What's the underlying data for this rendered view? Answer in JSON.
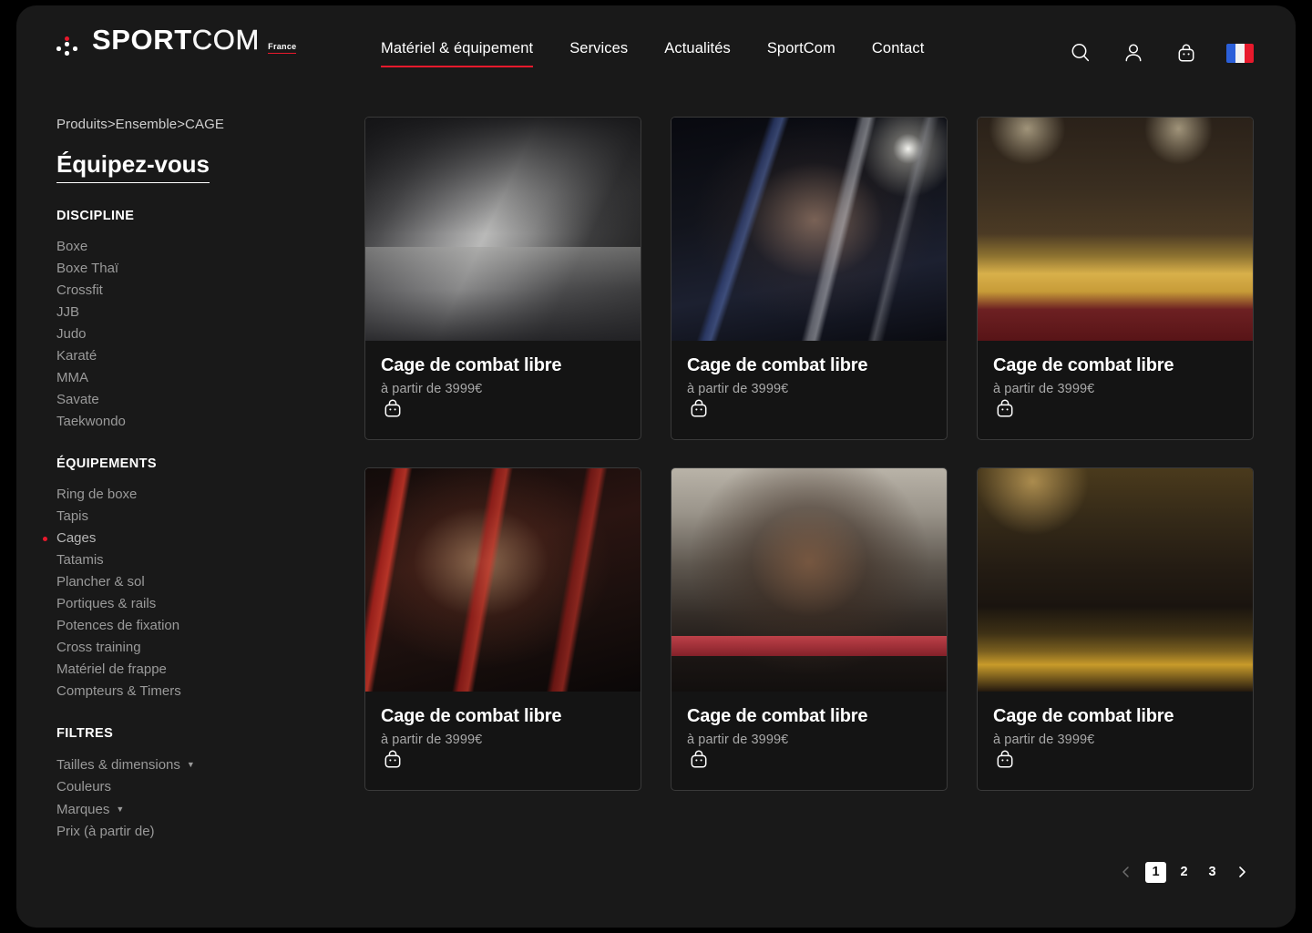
{
  "brand": {
    "name_bold": "SPORT",
    "name_thin": "COM",
    "sub": "France",
    "accent_color": "#e8192c"
  },
  "nav": {
    "items": [
      {
        "label": "Matériel & équipement",
        "active": true
      },
      {
        "label": "Services",
        "active": false
      },
      {
        "label": "Actualités",
        "active": false
      },
      {
        "label": "SportCom",
        "active": false
      },
      {
        "label": "Contact",
        "active": false
      }
    ]
  },
  "header_actions": {
    "search": "search-icon",
    "account": "user-icon",
    "cart": "shopping-bag-icon",
    "language": "fr-flag"
  },
  "sidebar": {
    "breadcrumb": "Produits>Ensemble>CAGE",
    "title": "Équipez-vous",
    "groups": [
      {
        "heading": "DISCIPLINE",
        "items": [
          {
            "label": "Boxe",
            "selected": false
          },
          {
            "label": "Boxe Thaï",
            "selected": false
          },
          {
            "label": "Crossfit",
            "selected": false
          },
          {
            "label": "JJB",
            "selected": false
          },
          {
            "label": "Judo",
            "selected": false
          },
          {
            "label": "Karaté",
            "selected": false
          },
          {
            "label": "MMA",
            "selected": false
          },
          {
            "label": "Savate",
            "selected": false
          },
          {
            "label": "Taekwondo",
            "selected": false
          }
        ]
      },
      {
        "heading": "ÉQUIPEMENTS",
        "items": [
          {
            "label": "Ring de boxe",
            "selected": false
          },
          {
            "label": "Tapis",
            "selected": false
          },
          {
            "label": "Cages",
            "selected": true
          },
          {
            "label": "Tatamis",
            "selected": false
          },
          {
            "label": "Plancher & sol",
            "selected": false
          },
          {
            "label": "Portiques & rails",
            "selected": false
          },
          {
            "label": "Potences de fixation",
            "selected": false
          },
          {
            "label": "Cross training",
            "selected": false
          },
          {
            "label": "Matériel de frappe",
            "selected": false
          },
          {
            "label": "Compteurs & Timers",
            "selected": false
          }
        ]
      },
      {
        "heading": "FILTRES",
        "items": [
          {
            "label": "Tailles & dimensions",
            "caret": "▼",
            "selected": false
          },
          {
            "label": "Couleurs",
            "selected": false
          },
          {
            "label": "Marques",
            "caret": "▼",
            "selected": false
          },
          {
            "label": "Prix (à partir de)",
            "selected": false
          }
        ]
      }
    ]
  },
  "products": [
    {
      "title": "Cage de combat libre",
      "price": "à partir de 3999€",
      "cart_icon": "shopping-bag-icon",
      "photo": "gym-cage-interior-grey"
    },
    {
      "title": "Cage de combat libre",
      "price": "à partir de 3999€",
      "cart_icon": "shopping-bag-icon",
      "photo": "muay-thai-fight-ring"
    },
    {
      "title": "Cage de combat libre",
      "price": "à partir de 3999€",
      "cart_icon": "shopping-bag-icon",
      "photo": "boxing-gym-yellow-ring"
    },
    {
      "title": "Cage de combat libre",
      "price": "à partir de 3999€",
      "cart_icon": "shopping-bag-icon",
      "photo": "red-ropes-dark-gym"
    },
    {
      "title": "Cage de combat libre",
      "price": "à partir de 3999€",
      "cart_icon": "shopping-bag-icon",
      "photo": "boxer-leaning-on-ropes"
    },
    {
      "title": "Cage de combat libre",
      "price": "à partir de 3999€",
      "cart_icon": "shopping-bag-icon",
      "photo": "arena-ring-wide-shot"
    }
  ],
  "pagination": {
    "prev": "‹",
    "next": "›",
    "pages": [
      {
        "label": "1",
        "active": true
      },
      {
        "label": "2",
        "active": false
      },
      {
        "label": "3",
        "active": false
      }
    ]
  }
}
